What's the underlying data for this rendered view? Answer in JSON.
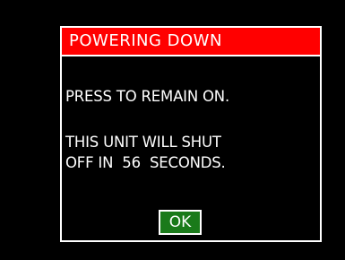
{
  "dialog": {
    "title": "POWERING DOWN",
    "message_line_1": "PRESS TO REMAIN ON.",
    "message_line_2": "THIS UNIT WILL SHUT",
    "message_line_3": "OFF IN  56  SECONDS.",
    "ok_label": "OK"
  },
  "colors": {
    "background": "#000000",
    "title_bar": "#ff0000",
    "border": "#ffffff",
    "ok_button": "#1a7a1a",
    "text": "#ffffff"
  }
}
